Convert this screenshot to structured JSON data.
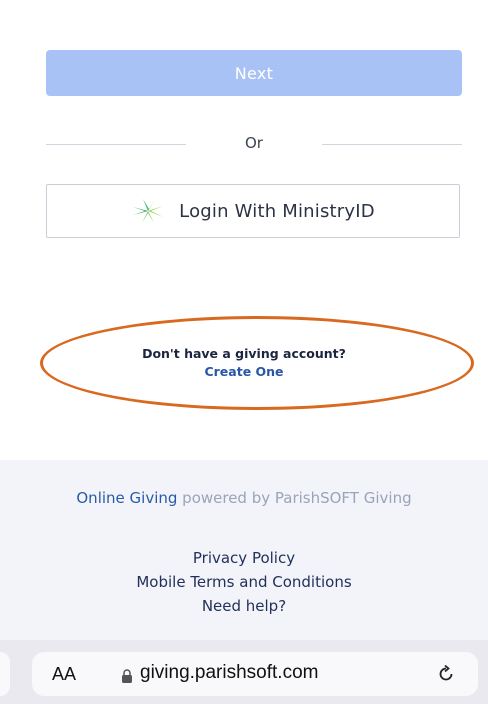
{
  "form": {
    "next_label": "Next",
    "or_label": "Or",
    "ministry_login_label": "Login With MinistryID",
    "ministry_icon": "ministryid-star-icon"
  },
  "account": {
    "question": "Don't have a giving account?",
    "create_label": "Create One"
  },
  "footer": {
    "brand": "Online Giving",
    "powered_by": "powered by ParishSOFT Giving",
    "links": [
      "Privacy Policy",
      "Mobile Terms and Conditions",
      "Need help?"
    ]
  },
  "browser": {
    "text_size_label": "AA",
    "url": "giving.parishsoft.com",
    "lock_icon": "lock-icon",
    "reload_icon": "reload-icon"
  },
  "colors": {
    "next_button": "#a9c2f5",
    "annotation": "#d8691f",
    "link": "#2956a8",
    "footer_bg": "#f3f4fa"
  }
}
